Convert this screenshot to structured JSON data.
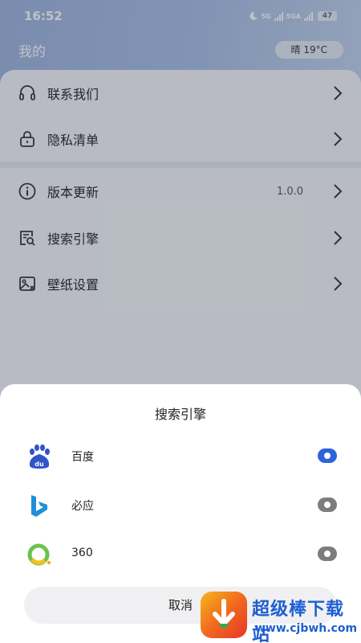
{
  "status_bar": {
    "time": "16:52",
    "network_1": "5G",
    "network_2": "5GA",
    "battery": "47"
  },
  "header": {
    "title": "我的",
    "weather": "晴 19°C"
  },
  "menu": {
    "items": [
      {
        "label": "联系我们",
        "icon": "headset-icon"
      },
      {
        "label": "隐私清单",
        "icon": "lock-icon"
      },
      {
        "label": "版本更新",
        "icon": "info-icon",
        "value": "1.0.0"
      },
      {
        "label": "搜索引擎",
        "icon": "search-engine-icon"
      },
      {
        "label": "壁纸设置",
        "icon": "wallpaper-icon"
      }
    ]
  },
  "sheet": {
    "title": "搜索引擎",
    "options": [
      {
        "label": "百度",
        "logo": "baidu-logo",
        "selected": true
      },
      {
        "label": "必应",
        "logo": "bing-logo",
        "selected": false
      },
      {
        "label": "360",
        "logo": "360-logo",
        "selected": false
      }
    ],
    "cancel_label": "取消"
  },
  "watermark": {
    "title": "超级棒下载站",
    "url": "www.cjbwh.com"
  },
  "colors": {
    "accent": "#2e63d9",
    "radio_off": "#7d7d7d",
    "header_gradient": "#a9bfe3"
  }
}
